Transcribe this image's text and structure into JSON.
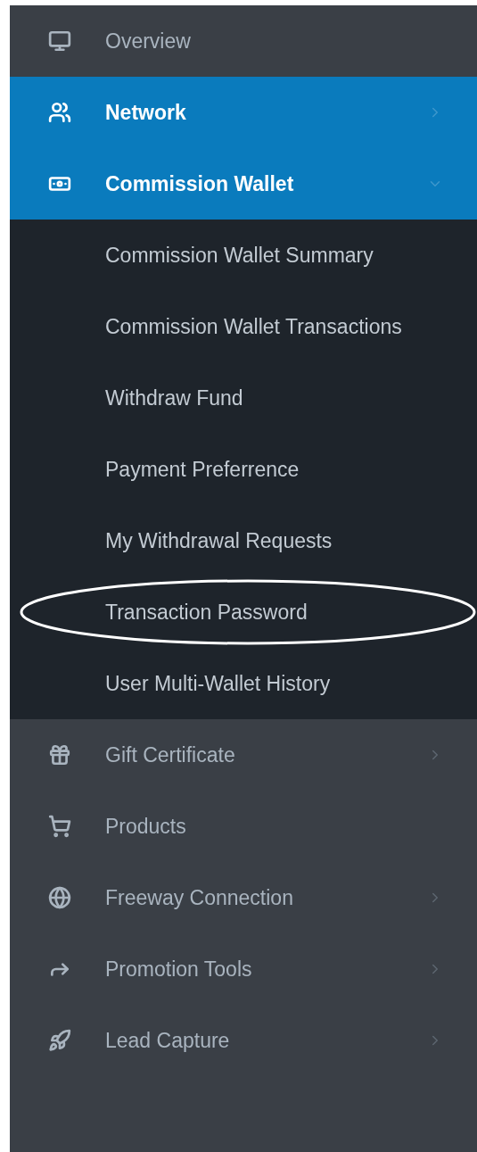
{
  "menu": [
    {
      "label": "Overview",
      "active": false
    },
    {
      "label": "Network",
      "active": true,
      "expanded": false
    },
    {
      "label": "Commission Wallet",
      "active": true,
      "expanded": true,
      "children": [
        {
          "label": "Commission Wallet Summary"
        },
        {
          "label": "Commission Wallet Transactions"
        },
        {
          "label": "Withdraw Fund"
        },
        {
          "label": "Payment Preferrence"
        },
        {
          "label": "My Withdrawal Requests"
        },
        {
          "label": "Transaction Password",
          "circled": true
        },
        {
          "label": "User Multi-Wallet History"
        }
      ]
    },
    {
      "label": "Gift Certificate",
      "active": false,
      "expanded": false
    },
    {
      "label": "Products",
      "active": false
    },
    {
      "label": "Freeway Connection",
      "active": false,
      "expanded": false
    },
    {
      "label": "Promotion Tools",
      "active": false,
      "expanded": false
    },
    {
      "label": "Lead Capture",
      "active": false,
      "expanded": false
    }
  ]
}
